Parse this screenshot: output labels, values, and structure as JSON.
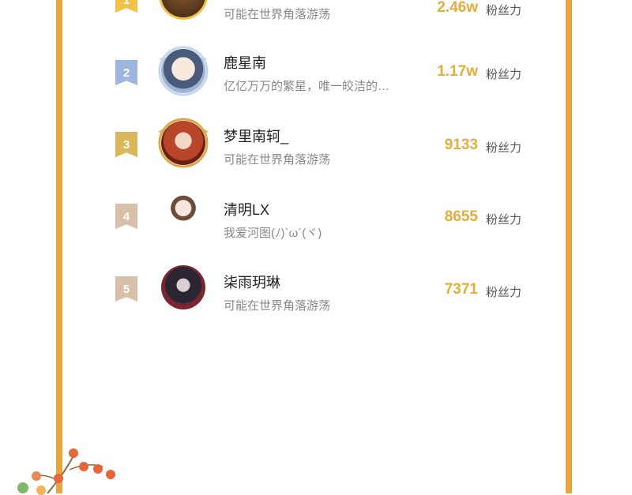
{
  "unit_label": "粉丝力",
  "colors": {
    "accent": "#e9a43c",
    "count": "#e3ad3c",
    "rank1": "#f0c24a",
    "rank2": "#9cb6de",
    "rank3": "#d9b75a",
    "rank_other": "#d8bfa7"
  },
  "rows": [
    {
      "rank": "1",
      "name": "",
      "signature": "可能在世界角落游荡",
      "count": "2.46w"
    },
    {
      "rank": "2",
      "name": "鹿星南",
      "signature": "亿亿万万的繁星，唯一皎洁的…",
      "count": "1.17w"
    },
    {
      "rank": "3",
      "name": "梦里南轲_",
      "signature": "可能在世界角落游荡",
      "count": "9133"
    },
    {
      "rank": "4",
      "name": "清明LX",
      "signature": "我爱河图(ﾉ)`ω´(ヾ)",
      "count": "8655"
    },
    {
      "rank": "5",
      "name": "柒雨玥琳",
      "signature": "可能在世界角落游荡",
      "count": "7371"
    }
  ]
}
